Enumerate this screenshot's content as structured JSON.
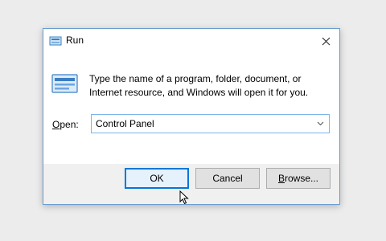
{
  "window": {
    "title": "Run",
    "close_icon": "close-icon",
    "app_icon": "run-icon"
  },
  "body": {
    "description": "Type the name of a program, folder, document, or Internet resource, and Windows will open it for you.",
    "open_label_prefix": "O",
    "open_label_rest": "pen:",
    "open_value": "Control Panel"
  },
  "buttons": {
    "ok": "OK",
    "cancel": "Cancel",
    "browse_prefix": "B",
    "browse_rest": "rowse..."
  },
  "colors": {
    "accent": "#0078d7",
    "dialog_border": "#6a9cd0",
    "footer_bg": "#f0f0f0",
    "field_border": "#7eb4ea"
  }
}
